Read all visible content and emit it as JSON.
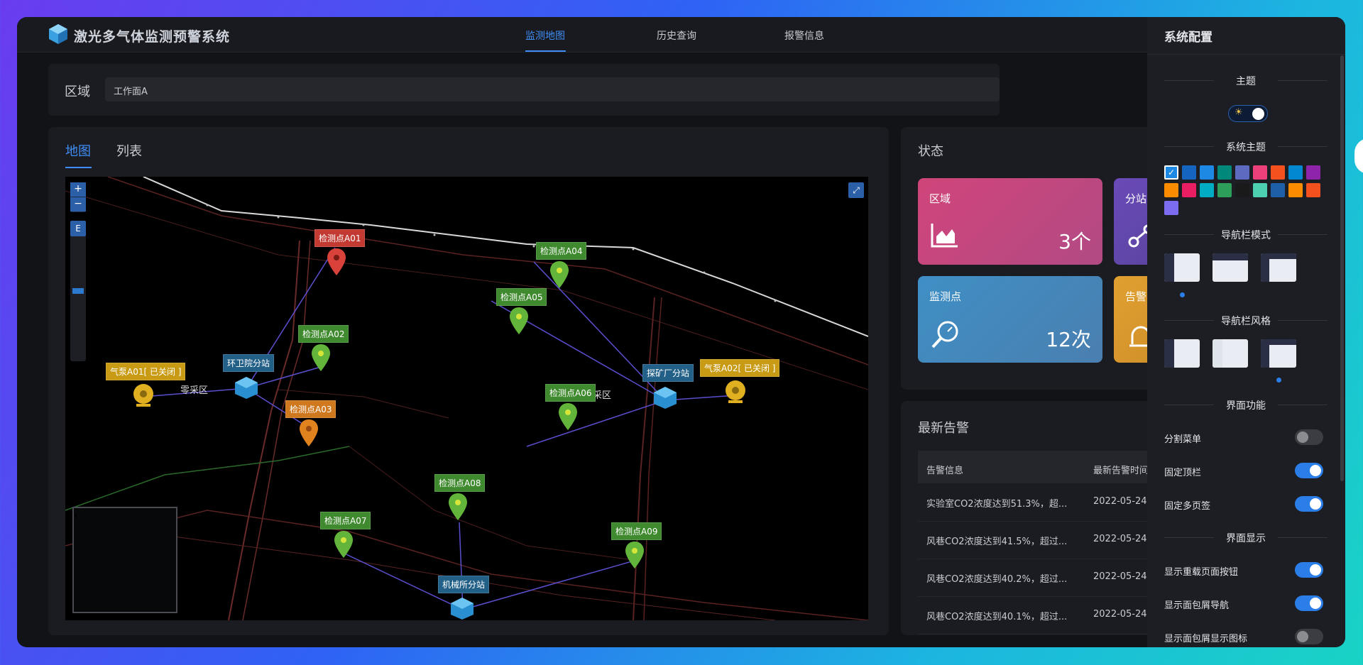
{
  "app": {
    "title": "激光多气体监测预警系统"
  },
  "nav": {
    "items": [
      "监测地图",
      "历史查询",
      "报警信息"
    ],
    "active": 0
  },
  "region": {
    "label": "区域",
    "value": "工作面A"
  },
  "map_tabs": {
    "items": [
      "地图",
      "列表"
    ],
    "active": 0
  },
  "map": {
    "zoom_in": "+",
    "zoom_out": "−",
    "slider_label": "E",
    "fullscreen": "⤢",
    "minimap_back": "‹",
    "points": [
      {
        "label": "检测点A01",
        "color": "red"
      },
      {
        "label": "检测点A02",
        "color": "green"
      },
      {
        "label": "检测点A03",
        "color": "orange"
      },
      {
        "label": "检测点A04",
        "color": "green"
      },
      {
        "label": "检测点A05",
        "color": "green"
      },
      {
        "label": "检测点A06",
        "color": "green"
      },
      {
        "label": "检测点A07",
        "color": "green"
      },
      {
        "label": "检测点A08",
        "color": "green"
      },
      {
        "label": "检测点A09",
        "color": "green"
      }
    ],
    "stations": [
      "环卫院分站",
      "探矿厂分站",
      "机械所分站"
    ],
    "pumps": [
      "气泵A01[ 已关闭 ]",
      "气泵A02[ 已关闭 ]"
    ],
    "areas": [
      "零采区",
      "北二采区"
    ]
  },
  "status": {
    "title": "状态",
    "cards": [
      {
        "name": "区域",
        "value": "3个",
        "icon": "area-chart-icon",
        "color": "#c74a7a"
      },
      {
        "name": "分站",
        "value": "",
        "icon": "network-icon",
        "color": "#6a4aa8"
      },
      {
        "name": "监测点",
        "value": "12次",
        "icon": "search-gauge-icon",
        "color": "#4a8bb8"
      },
      {
        "name": "告警",
        "value": "",
        "icon": "alarm-icon",
        "color": "#d9982a"
      }
    ]
  },
  "alerts": {
    "title": "最新告警",
    "columns": [
      "告警信息",
      "最新告警时间"
    ],
    "rows": [
      {
        "info": "实验室CO2浓度达到51.3%，超...",
        "time": "2022-05-24"
      },
      {
        "info": "风巷CO2浓度达到41.5%，超过...",
        "time": "2022-05-24"
      },
      {
        "info": "风巷CO2浓度达到40.2%，超过...",
        "time": "2022-05-24"
      },
      {
        "info": "风巷CO2浓度达到40.1%，超过...",
        "time": "2022-05-24"
      }
    ]
  },
  "settings": {
    "title": "系统配置",
    "theme_section": "主题",
    "theme_toggle": {
      "icon": "sun-icon",
      "glyph": "☀",
      "state": "dark"
    },
    "system_theme_section": "系统主题",
    "swatches": [
      "#1e88e5",
      "#1565c0",
      "#1e88e5",
      "#00897b",
      "#5c6bc0",
      "#ec407a",
      "#f4511e",
      "#0288d1",
      "#8e24aa",
      "#fb8c00",
      "#e91e63",
      "#00acc1",
      "#2e9e5b",
      "#1a1a1a",
      "#4dd0b1",
      "#1e5fa8",
      "#fb8c00",
      "#f4511e",
      "#7c6cf0"
    ],
    "selected_swatch": 0,
    "nav_mode_section": "导航栏模式",
    "nav_style_section": "导航栏风格",
    "nav_mode_selected": 0,
    "nav_style_selected": 2,
    "features_section": "界面功能",
    "features": [
      {
        "label": "分割菜单",
        "on": false
      },
      {
        "label": "固定顶栏",
        "on": true
      },
      {
        "label": "固定多页签",
        "on": true
      }
    ],
    "display_section": "界面显示",
    "display": [
      {
        "label": "显示重载页面按钮",
        "on": true
      },
      {
        "label": "显示面包屑导航",
        "on": true
      },
      {
        "label": "显示面包屑显示图标",
        "on": false
      }
    ]
  }
}
